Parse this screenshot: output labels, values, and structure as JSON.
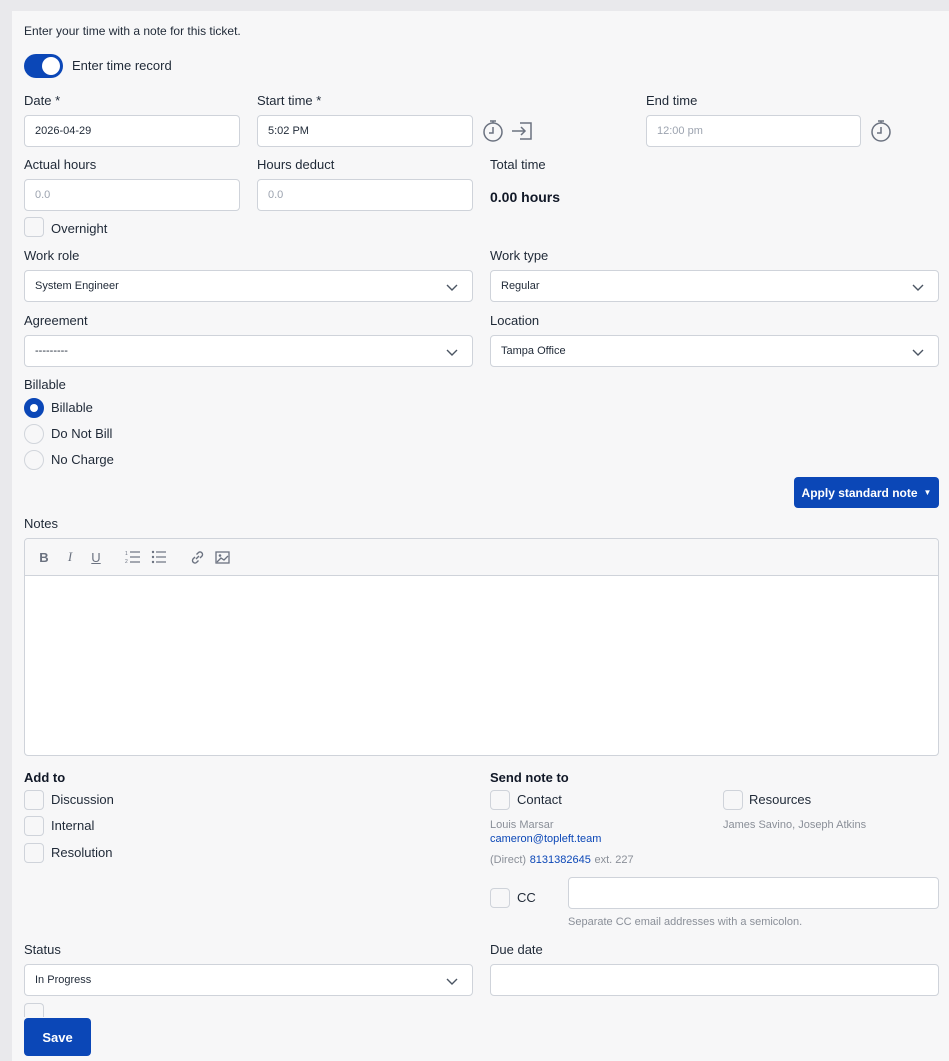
{
  "intro_text": "Enter your time with a note for this ticket.",
  "toggle": {
    "label": "Enter time record",
    "on": true
  },
  "date": {
    "label": "Date *",
    "value": "2026-04-29"
  },
  "start_time": {
    "label": "Start time *",
    "value": "5:02 PM"
  },
  "end_time": {
    "label": "End time",
    "placeholder": "12:00 pm"
  },
  "actual_hours": {
    "label": "Actual hours",
    "placeholder": "0.0"
  },
  "hours_deduct": {
    "label": "Hours deduct",
    "placeholder": "0.0"
  },
  "total_time": {
    "label": "Total time",
    "value": "0.00 hours"
  },
  "overnight": {
    "label": "Overnight",
    "checked": false
  },
  "work_role": {
    "label": "Work role",
    "value": "System Engineer"
  },
  "work_type": {
    "label": "Work type",
    "value": "Regular"
  },
  "agreement": {
    "label": "Agreement",
    "value": "---------"
  },
  "location": {
    "label": "Location",
    "value": "Tampa Office"
  },
  "billable": {
    "label": "Billable",
    "options": [
      "Billable",
      "Do Not Bill",
      "No Charge"
    ],
    "selected": "Billable"
  },
  "apply_standard_note": "Apply standard note",
  "notes": {
    "label": "Notes"
  },
  "icons": {
    "bold": "bold-icon",
    "italic": "italic-icon",
    "underline": "underline-icon",
    "ordered_list": "ordered-list-icon",
    "bullet_list": "bullet-list-icon",
    "link": "link-icon",
    "image": "image-icon",
    "timer": "stopwatch-icon",
    "sign_in": "sign-in-icon",
    "chevron": "chevron-down-icon"
  },
  "add_to": {
    "label": "Add to",
    "options": [
      "Discussion",
      "Internal",
      "Resolution"
    ]
  },
  "send_note_to": {
    "label": "Send note to",
    "contact": {
      "label": "Contact",
      "name": "Louis Marsar",
      "email": "cameron@topleft.team",
      "phone_prefix": "(Direct)",
      "phone": "8131382645",
      "ext": "ext. 227"
    },
    "resources": {
      "label": "Resources",
      "names": "James Savino, Joseph Atkins"
    },
    "cc": {
      "label": "CC",
      "help": "Separate CC email addresses with a semicolon."
    }
  },
  "status": {
    "label": "Status",
    "value": "In Progress"
  },
  "due_date": {
    "label": "Due date",
    "value": ""
  },
  "save_label": "Save",
  "colors": {
    "primary": "#0b47b7",
    "panel": "#f7f7f8",
    "border": "#cfd3da"
  }
}
